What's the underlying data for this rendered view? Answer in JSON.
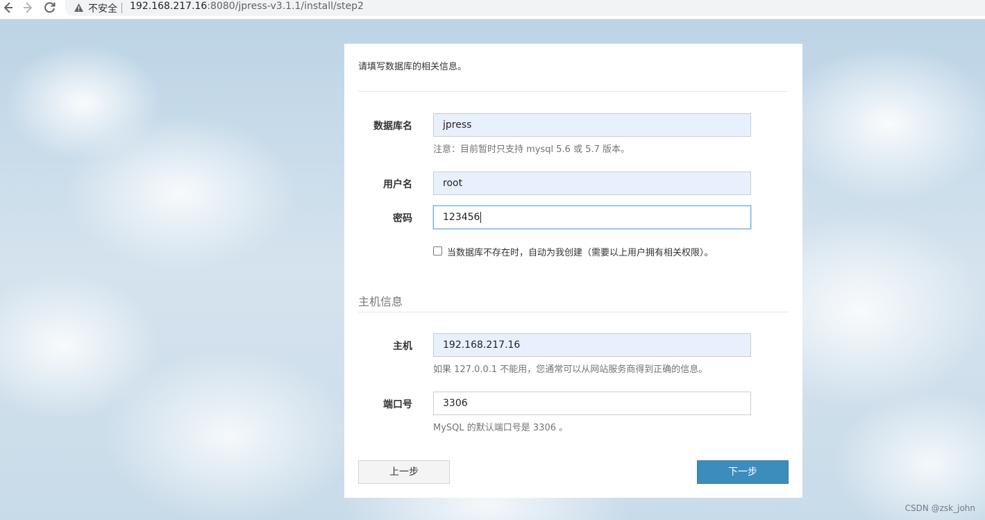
{
  "browser": {
    "security_label": "不安全",
    "url_host": "192.168.217.16",
    "url_rest": ":8080/jpress-v3.1.1/install/step2"
  },
  "form": {
    "intro": "请填写数据库的相关信息。",
    "db_name": {
      "label": "数据库名",
      "value": "jpress",
      "help": "注意：目前暂时只支持 mysql 5.6 或 5.7 版本。"
    },
    "username": {
      "label": "用户名",
      "value": "root"
    },
    "password": {
      "label": "密码",
      "value": "123456"
    },
    "auto_create": {
      "label": "当数据库不存在时，自动为我创建（需要以上用户拥有相关权限）。",
      "checked": false
    },
    "host_section_title": "主机信息",
    "host": {
      "label": "主机",
      "value": "192.168.217.16",
      "help": "如果 127.0.0.1 不能用，您通常可以从网站服务商得到正确的信息。"
    },
    "port": {
      "label": "端口号",
      "value": "3306",
      "help": "MySQL 的默认端口号是 3306 。"
    },
    "prev_button": "上一步",
    "next_button": "下一步"
  },
  "watermark": "CSDN @zsk_john",
  "colors": {
    "primary_button": "#3c8dbc",
    "autofill_background": "#e8f0fe",
    "focus_border": "#66afe9"
  }
}
